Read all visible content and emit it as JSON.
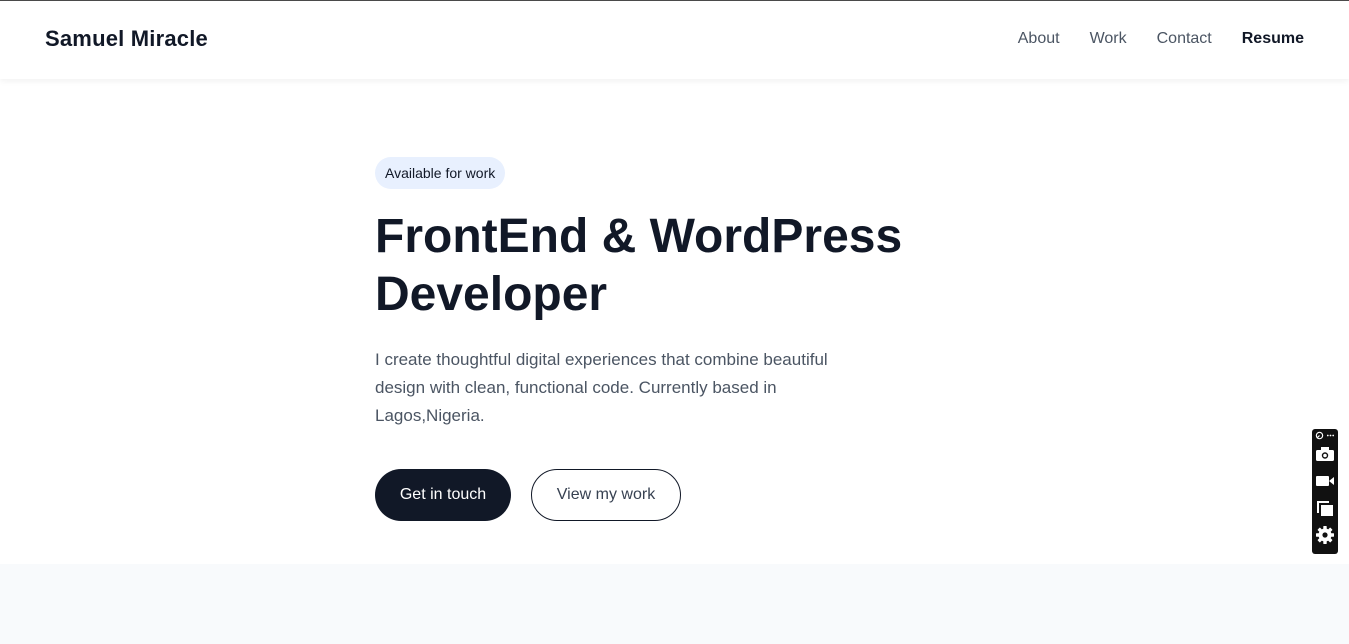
{
  "header": {
    "brand": "Samuel Miracle",
    "nav": [
      "About",
      "Work",
      "Contact",
      "Resume"
    ]
  },
  "hero": {
    "badge": "Available for work",
    "title_line1": "FrontEnd & WordPress",
    "title_line2": "Developer",
    "description": "I create thoughtful digital experiences that combine beautiful design with clean, functional code. Currently based in Lagos,Nigeria.",
    "primary_button": "Get in touch",
    "secondary_button": "View my work"
  },
  "toolbar": {
    "icons": [
      "pin-icon",
      "more-icon",
      "camera-icon",
      "video-icon",
      "window-icon",
      "gear-icon"
    ]
  },
  "colors": {
    "text_dark": "#111827",
    "text_muted": "#4b5563",
    "badge_bg": "#e8f0fe",
    "section_bg": "#f8fafc"
  }
}
